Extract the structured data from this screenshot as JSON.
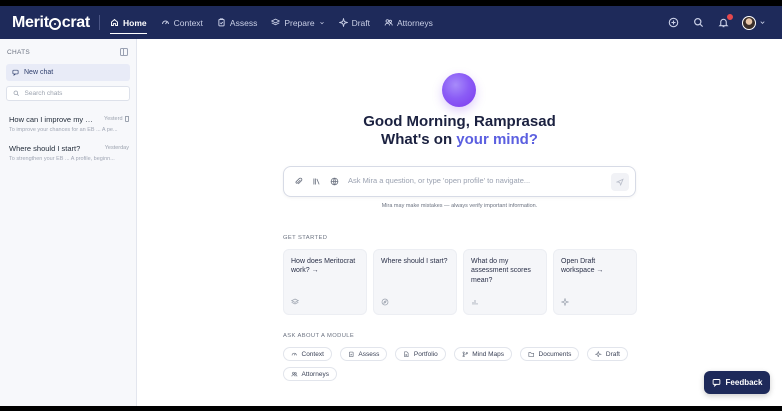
{
  "brand": {
    "logo_pre": "Merit",
    "logo_post": "crat"
  },
  "nav": {
    "items": [
      {
        "label": "Home",
        "icon": "home-icon",
        "active": true
      },
      {
        "label": "Context",
        "icon": "context-icon"
      },
      {
        "label": "Assess",
        "icon": "assess-icon"
      },
      {
        "label": "Prepare",
        "icon": "layers-icon",
        "dropdown": true
      },
      {
        "label": "Draft",
        "icon": "sparkle-icon"
      },
      {
        "label": "Attorneys",
        "icon": "people-icon"
      }
    ],
    "right_icons": [
      "plus-circle-icon",
      "search-icon",
      "bell-icon",
      "avatar"
    ]
  },
  "sidebar": {
    "heading": "CHATS",
    "new_chat": "New chat",
    "search_placeholder": "Search chats",
    "chats": [
      {
        "title": "How can I improve my EB ...",
        "time": "Yesterd",
        "preview": "To improve your chances for an EB ... A pe..."
      },
      {
        "title": "Where should I start?",
        "time": "Yesterday",
        "preview": "To strengthen your EB ... A profile, beginn..."
      }
    ]
  },
  "main": {
    "greeting_line1": "Good Morning, Ramprasad",
    "greeting_line2_pre": "What's on ",
    "greeting_line2_accent": "your mind?",
    "ask_placeholder": "Ask Mira a question, or type 'open profile' to navigate...",
    "disclaimer": "Mira may make mistakes — always verify important information.",
    "get_started_label": "GET STARTED",
    "cards": [
      {
        "text": "How does Meritocrat work? →",
        "icon": "stack-icon"
      },
      {
        "text": "Where should I start?",
        "icon": "compass-icon"
      },
      {
        "text": "What do my assessment scores mean?",
        "icon": "bar-chart-icon"
      },
      {
        "text": "Open Draft workspace →",
        "icon": "sparkle-icon"
      }
    ],
    "module_label": "ASK ABOUT A MODULE",
    "modules": [
      {
        "label": "Context",
        "icon": "context-icon"
      },
      {
        "label": "Assess",
        "icon": "assess-icon"
      },
      {
        "label": "Portfolio",
        "icon": "document-icon"
      },
      {
        "label": "Mind Maps",
        "icon": "branch-icon"
      },
      {
        "label": "Documents",
        "icon": "folder-icon"
      },
      {
        "label": "Draft",
        "icon": "sparkle-icon"
      },
      {
        "label": "Attorneys",
        "icon": "people-icon"
      }
    ]
  },
  "feedback": {
    "label": "Feedback"
  },
  "colors": {
    "nav_bg": "#1e2a5a",
    "accent": "#5b5fe0",
    "orb": "#8b5cf6"
  }
}
